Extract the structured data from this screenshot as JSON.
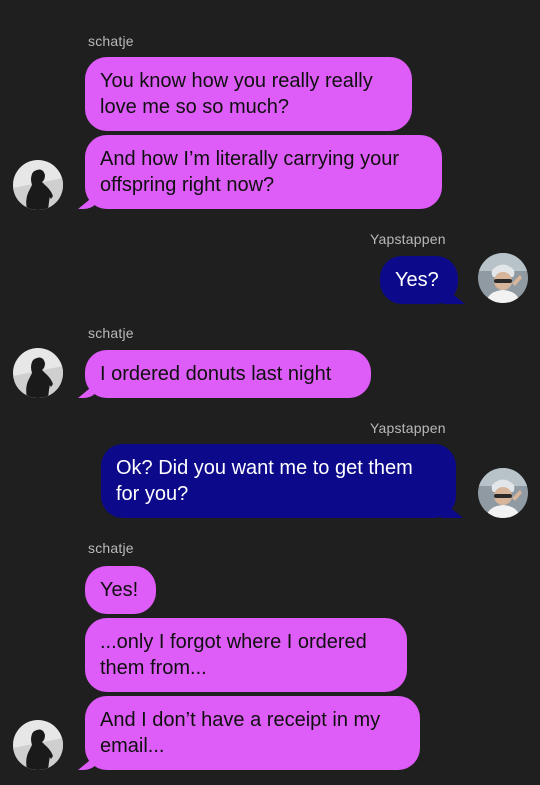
{
  "contacts": {
    "her": {
      "name": "schatje"
    },
    "me": {
      "name": "Yapstappen"
    }
  },
  "messages": [
    {
      "text": "You know how you really really love me so so much?"
    },
    {
      "text": "And how I’m literally carrying your offspring right now?"
    },
    {
      "text": "Yes?"
    },
    {
      "text": "I ordered donuts last night"
    },
    {
      "text": "Ok? Did you want me to get them for you?"
    },
    {
      "text": "Yes!"
    },
    {
      "text": "...only I forgot where I ordered them from..."
    },
    {
      "text": "And I don’t have a receipt in my email..."
    }
  ],
  "colors": {
    "background": "#1f1f1f",
    "incoming_bubble": "#de5cf7",
    "outgoing_bubble": "#0c0a8a"
  },
  "icons": {
    "her_avatar": "silhouette-avatar-icon",
    "me_avatar": "photo-avatar-icon"
  }
}
